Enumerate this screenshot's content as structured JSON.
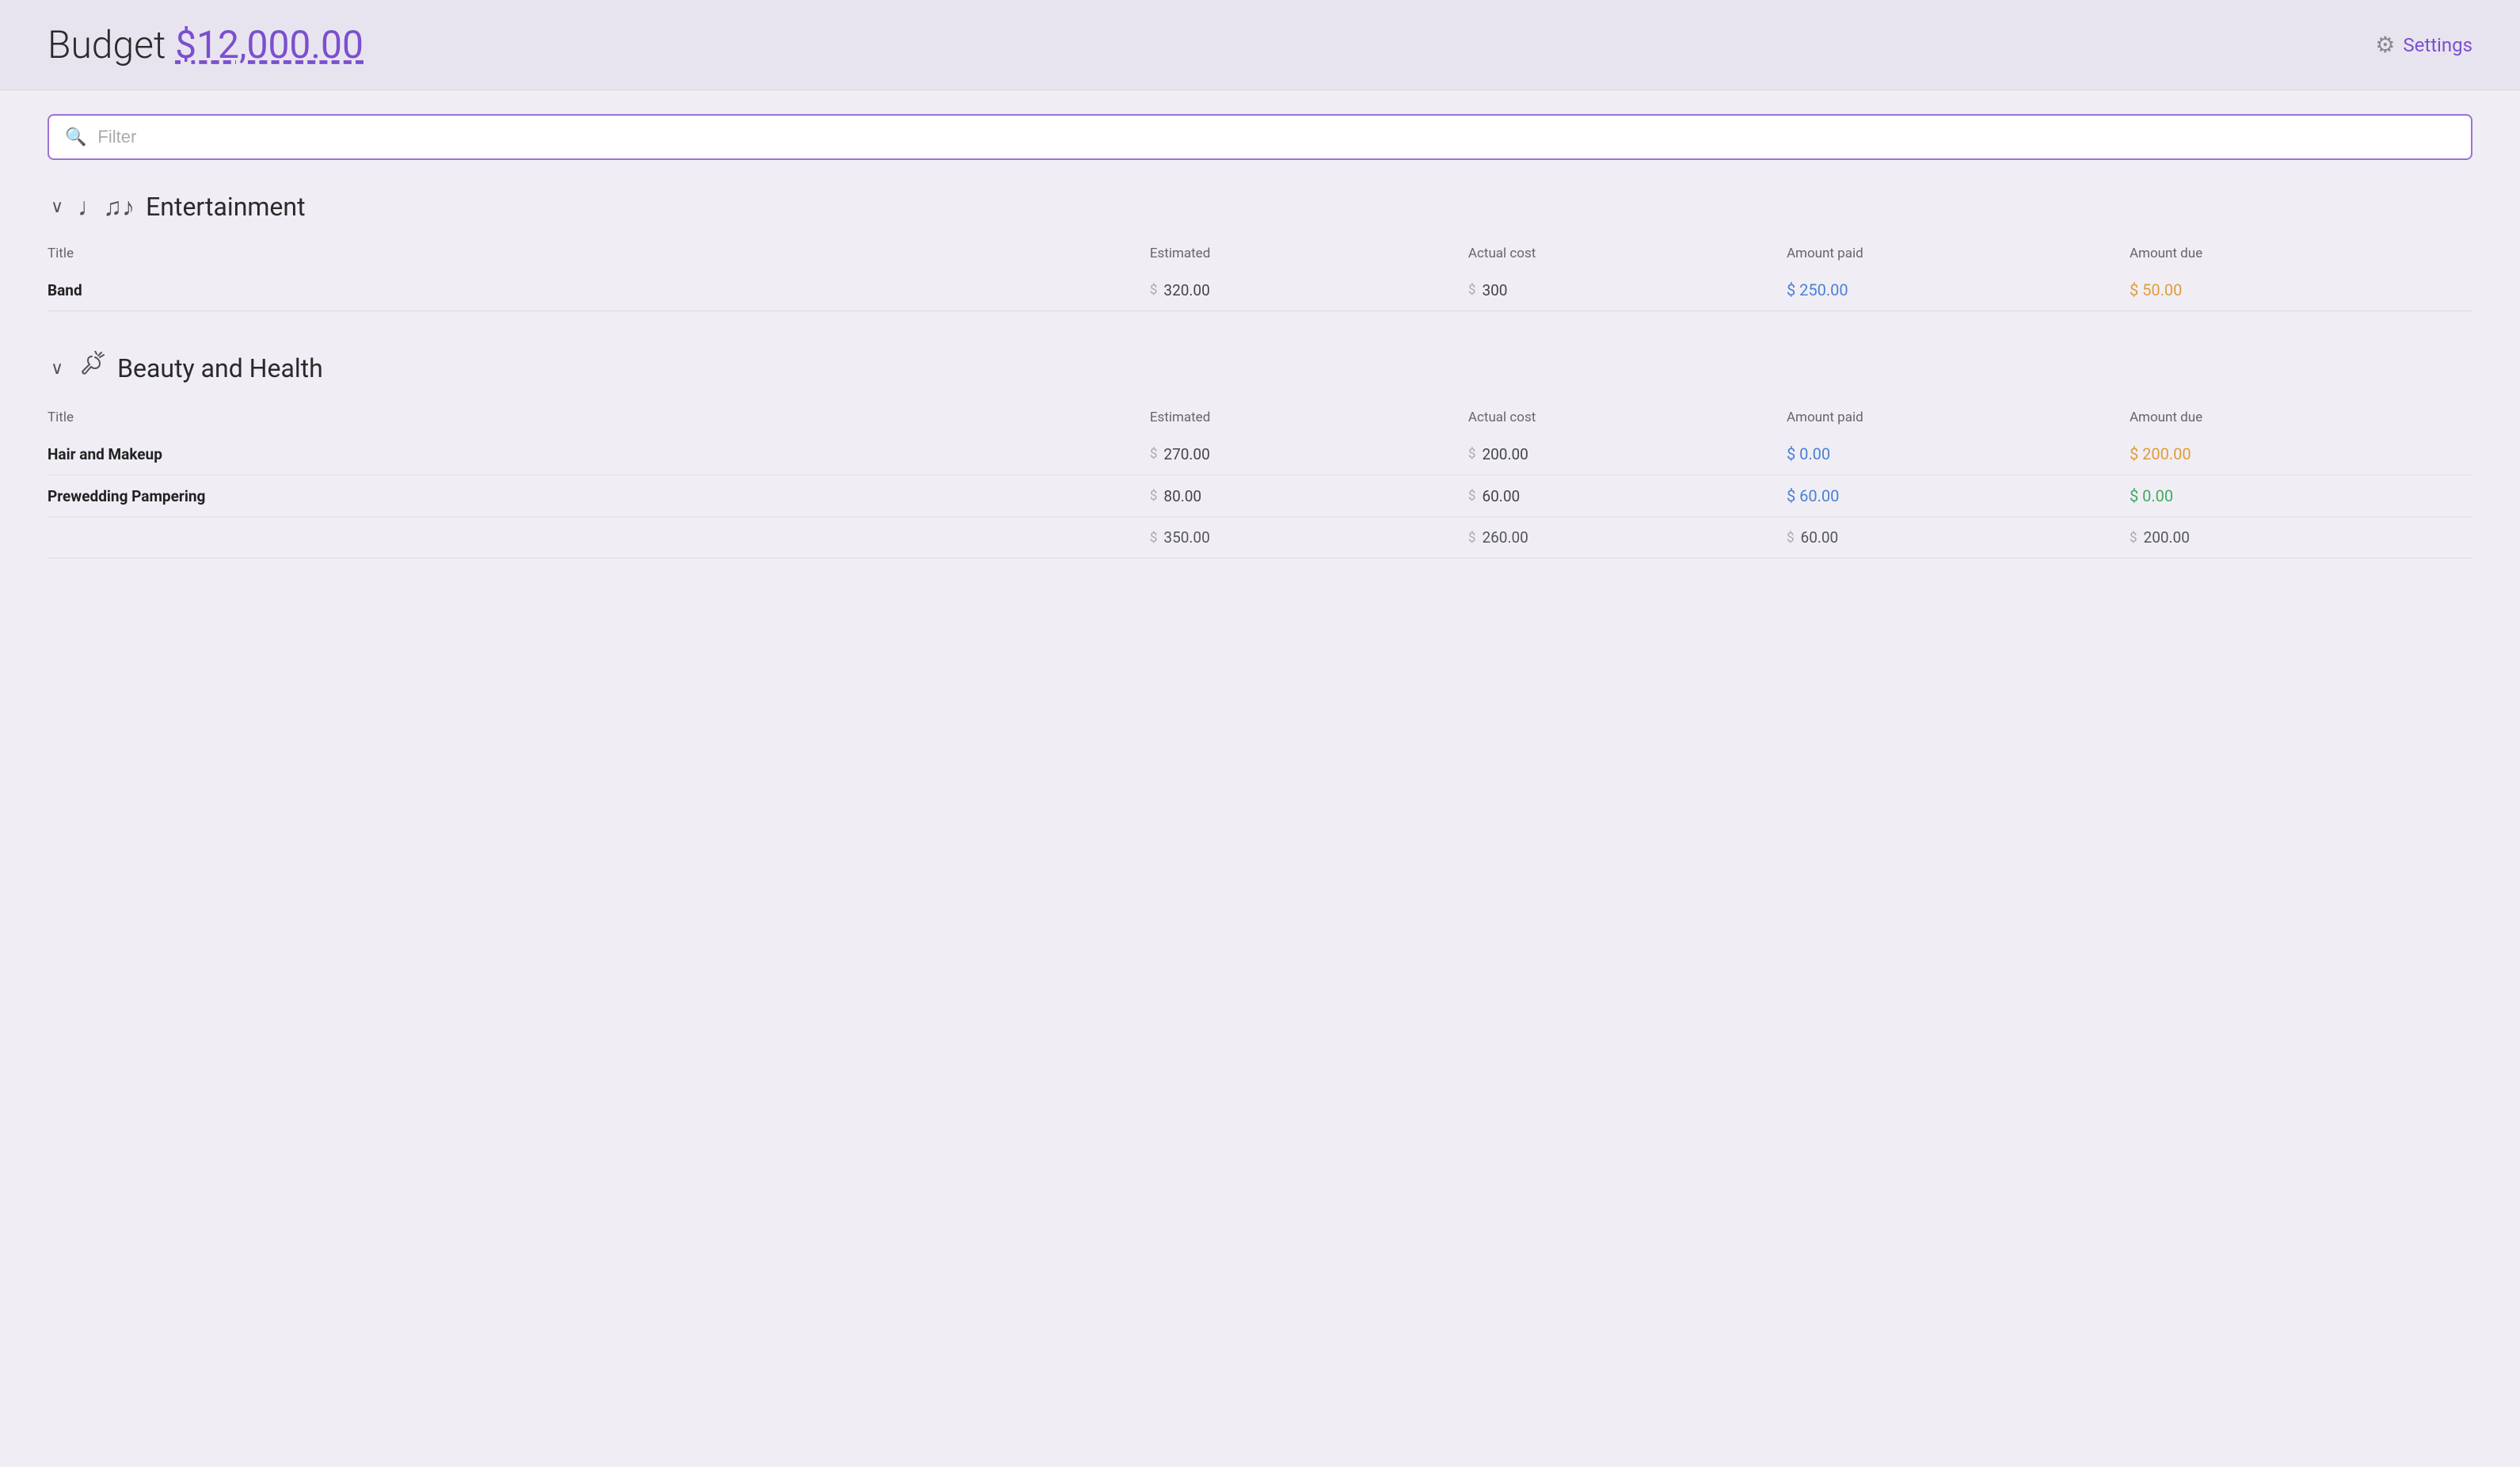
{
  "header": {
    "title_static": "Budget",
    "amount": "$12,000.00",
    "settings_label": "Settings"
  },
  "filter": {
    "placeholder": "Filter"
  },
  "categories": [
    {
      "id": "entertainment",
      "icon": "♩♫♪",
      "title": "Entertainment",
      "columns": [
        "Title",
        "Estimated",
        "Actual cost",
        "Amount paid",
        "Amount due"
      ],
      "items": [
        {
          "title": "Band",
          "estimated": "320.00",
          "actual": "300",
          "paid": "250.00",
          "paid_color": "blue",
          "due": "50.00",
          "due_color": "orange"
        }
      ],
      "totals": null
    },
    {
      "id": "beauty-health",
      "icon": "💇",
      "title": "Beauty and Health",
      "columns": [
        "Title",
        "Estimated",
        "Actual cost",
        "Amount paid",
        "Amount due"
      ],
      "items": [
        {
          "title": "Hair and Makeup",
          "estimated": "270.00",
          "actual": "200.00",
          "paid": "0.00",
          "paid_color": "blue",
          "due": "200.00",
          "due_color": "orange"
        },
        {
          "title": "Prewedding Pampering",
          "estimated": "80.00",
          "actual": "60.00",
          "paid": "60.00",
          "paid_color": "blue",
          "due": "0.00",
          "due_color": "green"
        }
      ],
      "totals": {
        "estimated": "350.00",
        "actual": "260.00",
        "paid": "60.00",
        "due": "200.00"
      }
    }
  ]
}
